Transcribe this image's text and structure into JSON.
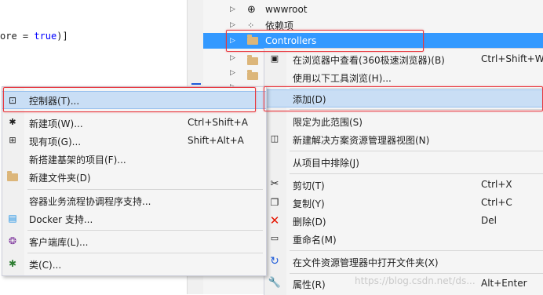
{
  "editor": {
    "code_prefix": "ore = ",
    "code_keyword": "true",
    "code_suffix": ")]"
  },
  "explorer": {
    "rows": [
      {
        "label": "wwwroot",
        "icon": "globe-icon"
      },
      {
        "label": "依赖项",
        "icon": "dependencies-icon"
      },
      {
        "label": "Controllers",
        "icon": "folder-icon"
      }
    ]
  },
  "main_menu": {
    "items": [
      {
        "label": "在浏览器中查看(360极速浏览器)(B)",
        "shortcut": "Ctrl+Shift+W",
        "icon": "browser-icon"
      },
      {
        "label": "使用以下工具浏览(H)...",
        "shortcut": "",
        "icon": ""
      },
      {
        "label": "添加(D)",
        "shortcut": "",
        "icon": ""
      },
      {
        "label": "限定为此范围(S)",
        "shortcut": "",
        "icon": ""
      },
      {
        "label": "新建解决方案资源管理器视图(N)",
        "shortcut": "",
        "icon": "new-view-icon"
      },
      {
        "label": "从项目中排除(J)",
        "shortcut": "",
        "icon": ""
      },
      {
        "label": "剪切(T)",
        "shortcut": "Ctrl+X",
        "icon": "scissors-icon"
      },
      {
        "label": "复制(Y)",
        "shortcut": "Ctrl+C",
        "icon": "copy-icon"
      },
      {
        "label": "删除(D)",
        "shortcut": "Del",
        "icon": "delete-icon"
      },
      {
        "label": "重命名(M)",
        "shortcut": "",
        "icon": "rename-icon"
      },
      {
        "label": "在文件资源管理器中打开文件夹(X)",
        "shortcut": "",
        "icon": "refresh-icon"
      },
      {
        "label": "属性(R)",
        "shortcut": "Alt+Enter",
        "icon": "wrench-icon"
      }
    ]
  },
  "sub_menu": {
    "items": [
      {
        "label": "控制器(T)...",
        "shortcut": "",
        "icon": "controller-icon"
      },
      {
        "label": "新建项(W)...",
        "shortcut": "Ctrl+Shift+A",
        "icon": "new-item-icon"
      },
      {
        "label": "现有项(G)...",
        "shortcut": "Shift+Alt+A",
        "icon": "existing-item-icon"
      },
      {
        "label": "新搭建基架的项目(F)...",
        "shortcut": "",
        "icon": ""
      },
      {
        "label": "新建文件夹(D)",
        "shortcut": "",
        "icon": "new-folder-icon"
      },
      {
        "label": "容器业务流程协调程序支持...",
        "shortcut": "",
        "icon": ""
      },
      {
        "label": "Docker 支持...",
        "shortcut": "",
        "icon": "docker-icon"
      },
      {
        "label": "客户端库(L)...",
        "shortcut": "",
        "icon": "client-library-icon"
      },
      {
        "label": "类(C)...",
        "shortcut": "",
        "icon": "class-icon"
      }
    ]
  },
  "watermark": "https://blog.csdn.net/ds...",
  "colors": {
    "selection": "#3399ff",
    "menu_highlight": "#c9def5",
    "annotation": "#e8373e"
  }
}
